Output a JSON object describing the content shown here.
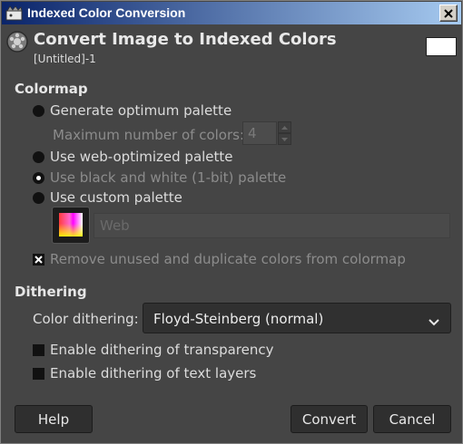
{
  "window": {
    "title": "Indexed Color Conversion"
  },
  "header": {
    "title": "Convert Image to Indexed Colors",
    "subtitle": "[Untitled]-1"
  },
  "colormap": {
    "heading": "Colormap",
    "option_optimum": "Generate optimum palette",
    "max_colors_label": "Maximum number of colors:",
    "max_colors_value": "4",
    "option_web": "Use web-optimized palette",
    "option_bw": "Use black and white (1-bit) palette",
    "option_custom": "Use custom palette",
    "custom_palette_name": "Web",
    "remove_unused_label": "Remove unused and duplicate colors from colormap",
    "selected_option": "Use black and white (1-bit) palette",
    "remove_unused_checked": true
  },
  "dithering": {
    "heading": "Dithering",
    "color_dithering_label": "Color dithering:",
    "color_dithering_value": "Floyd-Steinberg (normal)",
    "transparency_label": "Enable dithering of transparency",
    "transparency_checked": false,
    "text_layers_label": "Enable dithering of text layers",
    "text_layers_checked": false
  },
  "buttons": {
    "help": "Help",
    "convert": "Convert",
    "cancel": "Cancel"
  },
  "icons": {
    "app": "gimp-icon",
    "close": "close-icon",
    "header": "convert-indexed-icon",
    "palette": "palette-swatch-icon",
    "dropdown": "chevron-down-icon"
  },
  "colors": {
    "title_bar_start": "#0a246a",
    "title_bar_end": "#a6caf0",
    "dialog_bg": "#454545",
    "text": "#dcdcdc",
    "disabled_text": "#8c8c8c"
  }
}
